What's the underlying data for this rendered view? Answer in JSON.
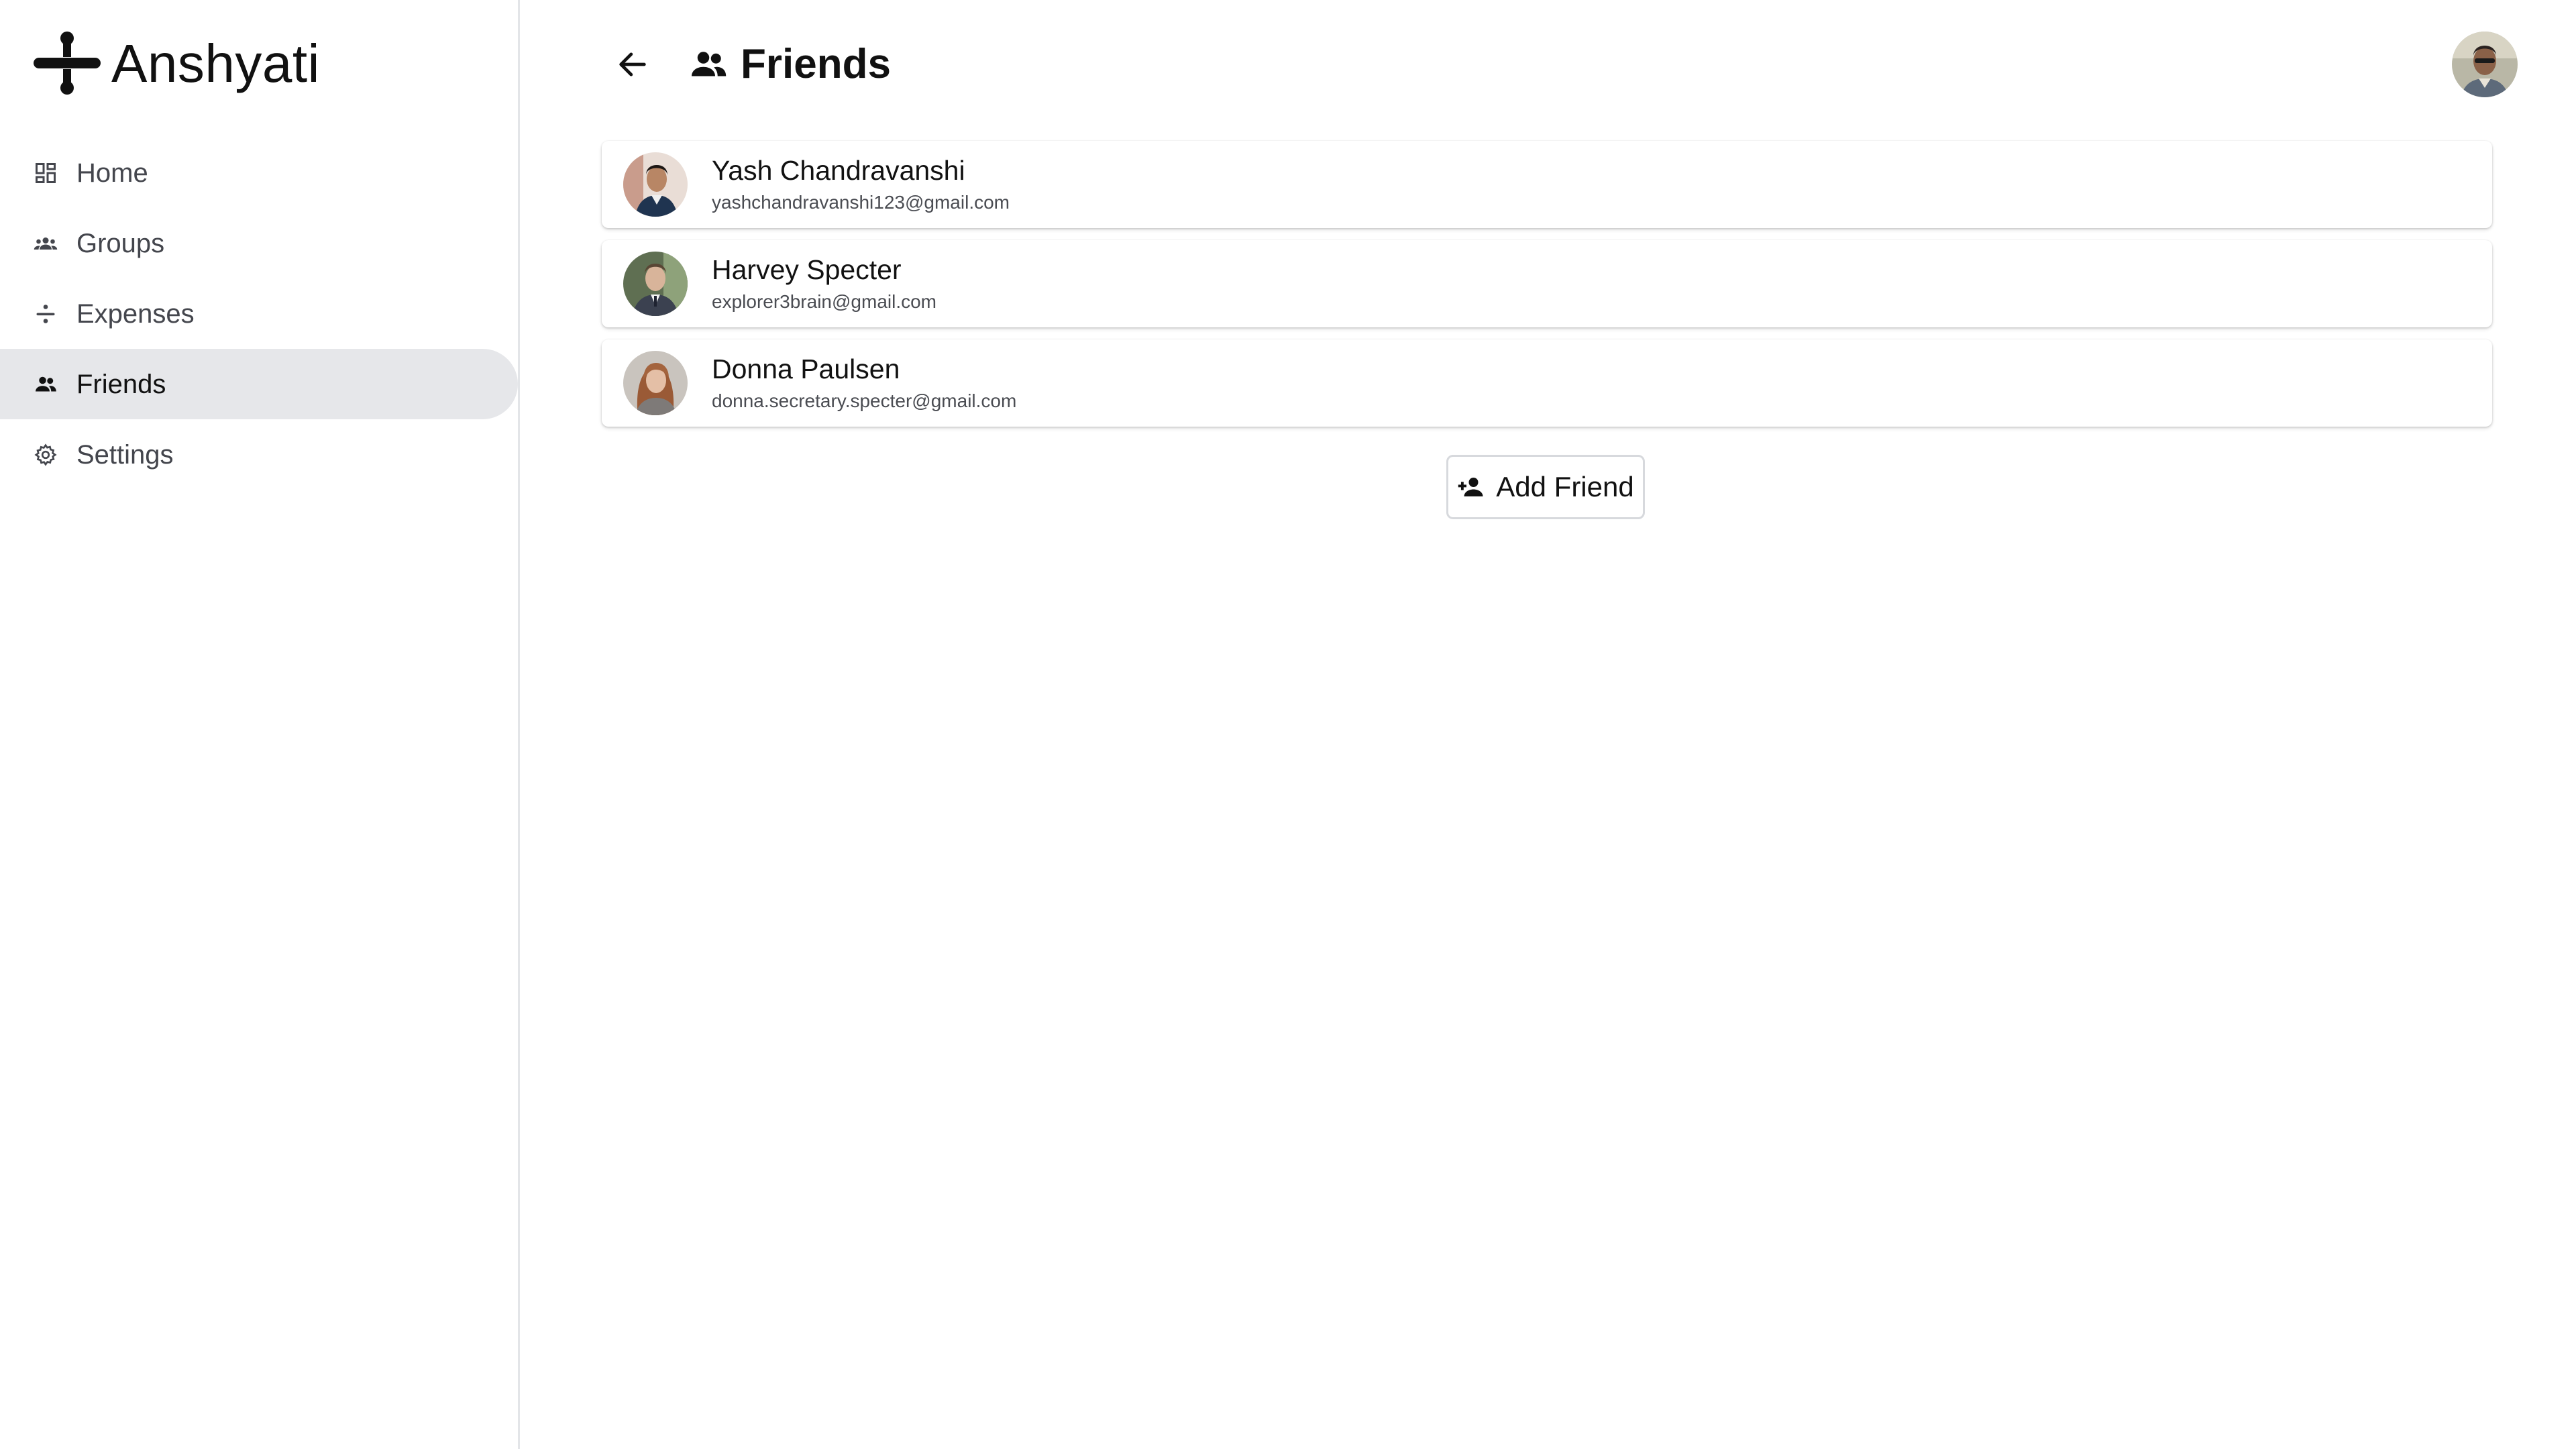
{
  "app": {
    "brand_name": "Anshyati",
    "brand_icon": "divide-logo-icon"
  },
  "sidebar": {
    "items": [
      {
        "label": "Home",
        "icon": "dashboard-grid-icon",
        "active": false
      },
      {
        "label": "Groups",
        "icon": "groups-icon",
        "active": false
      },
      {
        "label": "Expenses",
        "icon": "divide-icon",
        "active": false
      },
      {
        "label": "Friends",
        "icon": "people-icon",
        "active": true
      },
      {
        "label": "Settings",
        "icon": "gear-icon",
        "active": false
      }
    ]
  },
  "header": {
    "title": "Friends",
    "back_icon": "arrow-left-icon",
    "title_icon": "people-icon"
  },
  "friends": [
    {
      "name": "Yash Chandravanshi",
      "email": "yashchandravanshi123@gmail.com"
    },
    {
      "name": "Harvey Specter",
      "email": "explorer3brain@gmail.com"
    },
    {
      "name": "Donna Paulsen",
      "email": "donna.secretary.specter@gmail.com"
    }
  ],
  "actions": {
    "add_friend_label": "Add Friend",
    "add_friend_icon": "person-add-icon"
  },
  "colors": {
    "active_nav_bg": "#e6e7ea",
    "divider": "#e3e5e8",
    "text_primary": "#111111",
    "text_secondary": "#4a4c52"
  }
}
